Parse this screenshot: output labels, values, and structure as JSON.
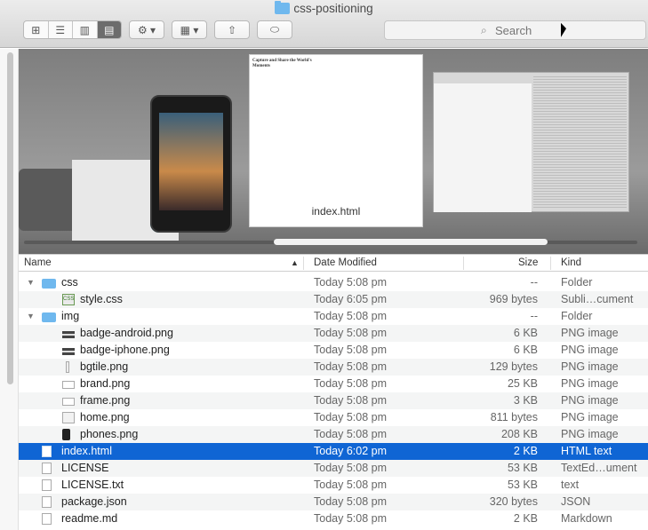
{
  "window": {
    "title": "css-positioning"
  },
  "toolbar": {
    "view_icons": [
      "⊞",
      "☰",
      "▥",
      "▤"
    ],
    "action_label": "⚙ ▾",
    "arrange_label": "▦ ▾",
    "share_label": "⇧",
    "tag_label": "⬭",
    "search_placeholder": "Search"
  },
  "preview": {
    "caption": "index.html",
    "doc_title": "Capture and Share the World's Moments"
  },
  "columns": {
    "name": "Name",
    "date": "Date Modified",
    "size": "Size",
    "kind": "Kind"
  },
  "rows": [
    {
      "name": "css",
      "date": "Today 5:08 pm",
      "size": "--",
      "kind": "Folder",
      "icon": "folder-icon",
      "indent": 0,
      "disclosure": "▼"
    },
    {
      "name": "style.css",
      "date": "Today 6:05 pm",
      "size": "969 bytes",
      "kind": "Subli…cument",
      "icon": "css-file-icon",
      "indent": 1
    },
    {
      "name": "img",
      "date": "Today 5:08 pm",
      "size": "--",
      "kind": "Folder",
      "icon": "folder-icon",
      "indent": 0,
      "disclosure": "▼"
    },
    {
      "name": "badge-android.png",
      "date": "Today 5:08 pm",
      "size": "6 KB",
      "kind": "PNG image",
      "icon": "image-icon",
      "indent": 1
    },
    {
      "name": "badge-iphone.png",
      "date": "Today 5:08 pm",
      "size": "6 KB",
      "kind": "PNG image",
      "icon": "image-icon",
      "indent": 1
    },
    {
      "name": "bgtile.png",
      "date": "Today 5:08 pm",
      "size": "129 bytes",
      "kind": "PNG image",
      "icon": "image-icon",
      "indent": 1
    },
    {
      "name": "brand.png",
      "date": "Today 5:08 pm",
      "size": "25 KB",
      "kind": "PNG image",
      "icon": "image-icon",
      "indent": 1
    },
    {
      "name": "frame.png",
      "date": "Today 5:08 pm",
      "size": "3 KB",
      "kind": "PNG image",
      "icon": "image-icon",
      "indent": 1
    },
    {
      "name": "home.png",
      "date": "Today 5:08 pm",
      "size": "811 bytes",
      "kind": "PNG image",
      "icon": "image-icon",
      "indent": 1
    },
    {
      "name": "phones.png",
      "date": "Today 5:08 pm",
      "size": "208 KB",
      "kind": "PNG image",
      "icon": "image-icon",
      "indent": 1
    },
    {
      "name": "index.html",
      "date": "Today 6:02 pm",
      "size": "2 KB",
      "kind": "HTML text",
      "icon": "html-file-icon",
      "indent": 0,
      "selected": true
    },
    {
      "name": "LICENSE",
      "date": "Today 5:08 pm",
      "size": "53 KB",
      "kind": "TextEd…ument",
      "icon": "document-icon",
      "indent": 0
    },
    {
      "name": "LICENSE.txt",
      "date": "Today 5:08 pm",
      "size": "53 KB",
      "kind": "text",
      "icon": "document-icon",
      "indent": 0
    },
    {
      "name": "package.json",
      "date": "Today 5:08 pm",
      "size": "320 bytes",
      "kind": "JSON",
      "icon": "document-icon",
      "indent": 0
    },
    {
      "name": "readme.md",
      "date": "Today 5:08 pm",
      "size": "2 KB",
      "kind": "Markdown",
      "icon": "document-icon",
      "indent": 0
    }
  ],
  "colors": {
    "selection": "#0f65d4",
    "folder": "#6fb8ee"
  }
}
